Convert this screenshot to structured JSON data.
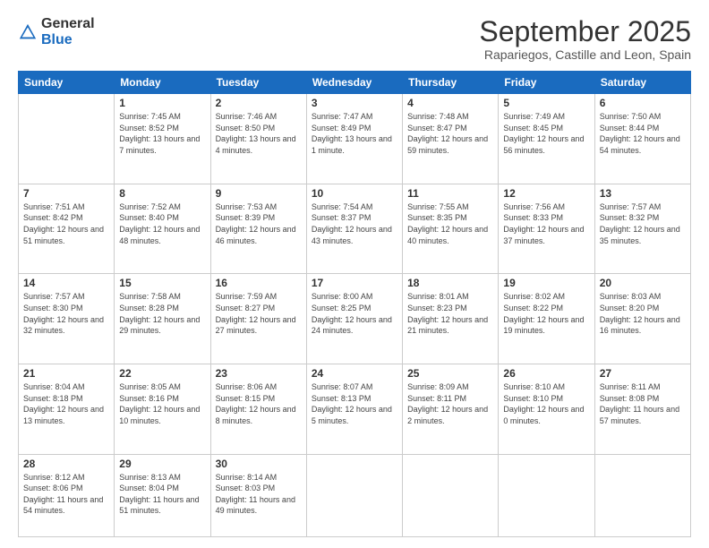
{
  "logo": {
    "general": "General",
    "blue": "Blue"
  },
  "header": {
    "month_title": "September 2025",
    "subtitle": "Rapariegos, Castille and Leon, Spain"
  },
  "weekdays": [
    "Sunday",
    "Monday",
    "Tuesday",
    "Wednesday",
    "Thursday",
    "Friday",
    "Saturday"
  ],
  "weeks": [
    [
      {
        "day": "",
        "sunrise": "",
        "sunset": "",
        "daylight": ""
      },
      {
        "day": "1",
        "sunrise": "Sunrise: 7:45 AM",
        "sunset": "Sunset: 8:52 PM",
        "daylight": "Daylight: 13 hours and 7 minutes."
      },
      {
        "day": "2",
        "sunrise": "Sunrise: 7:46 AM",
        "sunset": "Sunset: 8:50 PM",
        "daylight": "Daylight: 13 hours and 4 minutes."
      },
      {
        "day": "3",
        "sunrise": "Sunrise: 7:47 AM",
        "sunset": "Sunset: 8:49 PM",
        "daylight": "Daylight: 13 hours and 1 minute."
      },
      {
        "day": "4",
        "sunrise": "Sunrise: 7:48 AM",
        "sunset": "Sunset: 8:47 PM",
        "daylight": "Daylight: 12 hours and 59 minutes."
      },
      {
        "day": "5",
        "sunrise": "Sunrise: 7:49 AM",
        "sunset": "Sunset: 8:45 PM",
        "daylight": "Daylight: 12 hours and 56 minutes."
      },
      {
        "day": "6",
        "sunrise": "Sunrise: 7:50 AM",
        "sunset": "Sunset: 8:44 PM",
        "daylight": "Daylight: 12 hours and 54 minutes."
      }
    ],
    [
      {
        "day": "7",
        "sunrise": "Sunrise: 7:51 AM",
        "sunset": "Sunset: 8:42 PM",
        "daylight": "Daylight: 12 hours and 51 minutes."
      },
      {
        "day": "8",
        "sunrise": "Sunrise: 7:52 AM",
        "sunset": "Sunset: 8:40 PM",
        "daylight": "Daylight: 12 hours and 48 minutes."
      },
      {
        "day": "9",
        "sunrise": "Sunrise: 7:53 AM",
        "sunset": "Sunset: 8:39 PM",
        "daylight": "Daylight: 12 hours and 46 minutes."
      },
      {
        "day": "10",
        "sunrise": "Sunrise: 7:54 AM",
        "sunset": "Sunset: 8:37 PM",
        "daylight": "Daylight: 12 hours and 43 minutes."
      },
      {
        "day": "11",
        "sunrise": "Sunrise: 7:55 AM",
        "sunset": "Sunset: 8:35 PM",
        "daylight": "Daylight: 12 hours and 40 minutes."
      },
      {
        "day": "12",
        "sunrise": "Sunrise: 7:56 AM",
        "sunset": "Sunset: 8:33 PM",
        "daylight": "Daylight: 12 hours and 37 minutes."
      },
      {
        "day": "13",
        "sunrise": "Sunrise: 7:57 AM",
        "sunset": "Sunset: 8:32 PM",
        "daylight": "Daylight: 12 hours and 35 minutes."
      }
    ],
    [
      {
        "day": "14",
        "sunrise": "Sunrise: 7:57 AM",
        "sunset": "Sunset: 8:30 PM",
        "daylight": "Daylight: 12 hours and 32 minutes."
      },
      {
        "day": "15",
        "sunrise": "Sunrise: 7:58 AM",
        "sunset": "Sunset: 8:28 PM",
        "daylight": "Daylight: 12 hours and 29 minutes."
      },
      {
        "day": "16",
        "sunrise": "Sunrise: 7:59 AM",
        "sunset": "Sunset: 8:27 PM",
        "daylight": "Daylight: 12 hours and 27 minutes."
      },
      {
        "day": "17",
        "sunrise": "Sunrise: 8:00 AM",
        "sunset": "Sunset: 8:25 PM",
        "daylight": "Daylight: 12 hours and 24 minutes."
      },
      {
        "day": "18",
        "sunrise": "Sunrise: 8:01 AM",
        "sunset": "Sunset: 8:23 PM",
        "daylight": "Daylight: 12 hours and 21 minutes."
      },
      {
        "day": "19",
        "sunrise": "Sunrise: 8:02 AM",
        "sunset": "Sunset: 8:22 PM",
        "daylight": "Daylight: 12 hours and 19 minutes."
      },
      {
        "day": "20",
        "sunrise": "Sunrise: 8:03 AM",
        "sunset": "Sunset: 8:20 PM",
        "daylight": "Daylight: 12 hours and 16 minutes."
      }
    ],
    [
      {
        "day": "21",
        "sunrise": "Sunrise: 8:04 AM",
        "sunset": "Sunset: 8:18 PM",
        "daylight": "Daylight: 12 hours and 13 minutes."
      },
      {
        "day": "22",
        "sunrise": "Sunrise: 8:05 AM",
        "sunset": "Sunset: 8:16 PM",
        "daylight": "Daylight: 12 hours and 10 minutes."
      },
      {
        "day": "23",
        "sunrise": "Sunrise: 8:06 AM",
        "sunset": "Sunset: 8:15 PM",
        "daylight": "Daylight: 12 hours and 8 minutes."
      },
      {
        "day": "24",
        "sunrise": "Sunrise: 8:07 AM",
        "sunset": "Sunset: 8:13 PM",
        "daylight": "Daylight: 12 hours and 5 minutes."
      },
      {
        "day": "25",
        "sunrise": "Sunrise: 8:09 AM",
        "sunset": "Sunset: 8:11 PM",
        "daylight": "Daylight: 12 hours and 2 minutes."
      },
      {
        "day": "26",
        "sunrise": "Sunrise: 8:10 AM",
        "sunset": "Sunset: 8:10 PM",
        "daylight": "Daylight: 12 hours and 0 minutes."
      },
      {
        "day": "27",
        "sunrise": "Sunrise: 8:11 AM",
        "sunset": "Sunset: 8:08 PM",
        "daylight": "Daylight: 11 hours and 57 minutes."
      }
    ],
    [
      {
        "day": "28",
        "sunrise": "Sunrise: 8:12 AM",
        "sunset": "Sunset: 8:06 PM",
        "daylight": "Daylight: 11 hours and 54 minutes."
      },
      {
        "day": "29",
        "sunrise": "Sunrise: 8:13 AM",
        "sunset": "Sunset: 8:04 PM",
        "daylight": "Daylight: 11 hours and 51 minutes."
      },
      {
        "day": "30",
        "sunrise": "Sunrise: 8:14 AM",
        "sunset": "Sunset: 8:03 PM",
        "daylight": "Daylight: 11 hours and 49 minutes."
      },
      {
        "day": "",
        "sunrise": "",
        "sunset": "",
        "daylight": ""
      },
      {
        "day": "",
        "sunrise": "",
        "sunset": "",
        "daylight": ""
      },
      {
        "day": "",
        "sunrise": "",
        "sunset": "",
        "daylight": ""
      },
      {
        "day": "",
        "sunrise": "",
        "sunset": "",
        "daylight": ""
      }
    ]
  ]
}
